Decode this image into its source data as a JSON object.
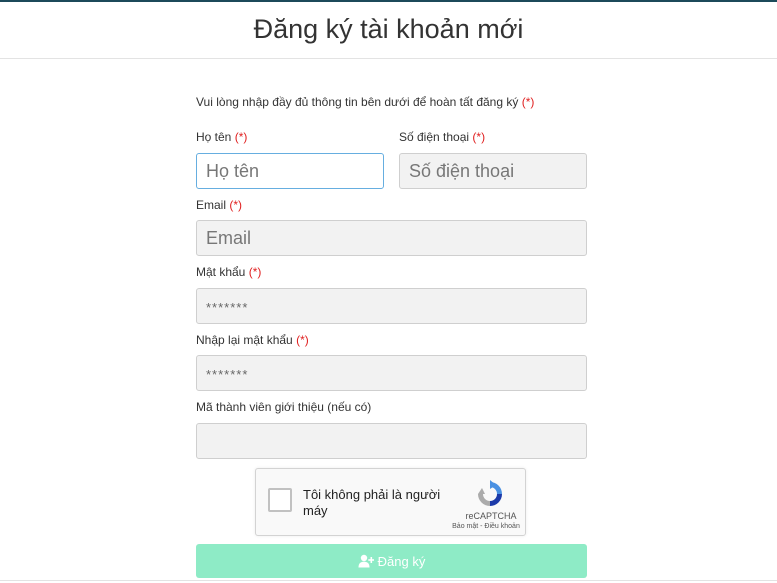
{
  "header": {
    "title": "Đăng ký tài khoản mới"
  },
  "form": {
    "intro": "Vui lòng nhập đầy đủ thông tin bên dưới để hoàn tất đăng ký",
    "required_mark": "(*)",
    "full_name": {
      "label": "Họ tên",
      "placeholder": "Họ tên"
    },
    "phone": {
      "label": "Số điện thoại",
      "placeholder": "Số điện thoại"
    },
    "email": {
      "label": "Email",
      "placeholder": "Email"
    },
    "password": {
      "label": "Mật khẩu",
      "placeholder": "*******"
    },
    "confirm_password": {
      "label": "Nhập lại mật khẩu",
      "placeholder": "*******"
    },
    "referral": {
      "label": "Mã thành viên giới thiệu (nếu có)",
      "placeholder": ""
    },
    "recaptcha": {
      "text": "Tôi không phải là người máy",
      "brand": "reCAPTCHA",
      "terms": "Bảo mật - Điều khoản"
    },
    "submit_label": "Đăng ký"
  },
  "icons": {
    "submit_icon": "user-plus-icon",
    "recaptcha_icon": "recaptcha-logo-icon"
  },
  "colors": {
    "submit_bg": "#8eebc6",
    "required": "#e02020",
    "focus_border": "#66aee0"
  }
}
